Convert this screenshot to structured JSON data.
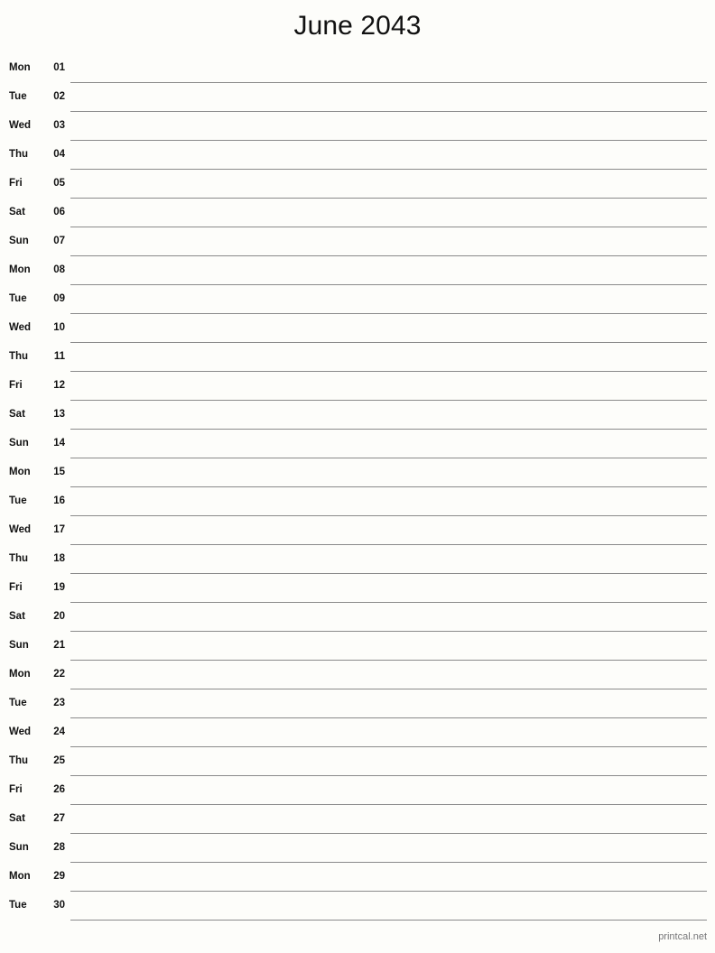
{
  "document": {
    "title": "June 2043",
    "month": "June",
    "year": "2043"
  },
  "calendar": {
    "days": [
      {
        "weekday": "Mon",
        "day": "01"
      },
      {
        "weekday": "Tue",
        "day": "02"
      },
      {
        "weekday": "Wed",
        "day": "03"
      },
      {
        "weekday": "Thu",
        "day": "04"
      },
      {
        "weekday": "Fri",
        "day": "05"
      },
      {
        "weekday": "Sat",
        "day": "06"
      },
      {
        "weekday": "Sun",
        "day": "07"
      },
      {
        "weekday": "Mon",
        "day": "08"
      },
      {
        "weekday": "Tue",
        "day": "09"
      },
      {
        "weekday": "Wed",
        "day": "10"
      },
      {
        "weekday": "Thu",
        "day": "11"
      },
      {
        "weekday": "Fri",
        "day": "12"
      },
      {
        "weekday": "Sat",
        "day": "13"
      },
      {
        "weekday": "Sun",
        "day": "14"
      },
      {
        "weekday": "Mon",
        "day": "15"
      },
      {
        "weekday": "Tue",
        "day": "16"
      },
      {
        "weekday": "Wed",
        "day": "17"
      },
      {
        "weekday": "Thu",
        "day": "18"
      },
      {
        "weekday": "Fri",
        "day": "19"
      },
      {
        "weekday": "Sat",
        "day": "20"
      },
      {
        "weekday": "Sun",
        "day": "21"
      },
      {
        "weekday": "Mon",
        "day": "22"
      },
      {
        "weekday": "Tue",
        "day": "23"
      },
      {
        "weekday": "Wed",
        "day": "24"
      },
      {
        "weekday": "Thu",
        "day": "25"
      },
      {
        "weekday": "Fri",
        "day": "26"
      },
      {
        "weekday": "Sat",
        "day": "27"
      },
      {
        "weekday": "Sun",
        "day": "28"
      },
      {
        "weekday": "Mon",
        "day": "29"
      },
      {
        "weekday": "Tue",
        "day": "30"
      }
    ]
  },
  "footer": {
    "attribution": "printcal.net"
  },
  "colors": {
    "page_background": "#fdfdfa",
    "text": "#111111",
    "rule_line": "#8a8a8a",
    "footer_text": "#78787a"
  }
}
